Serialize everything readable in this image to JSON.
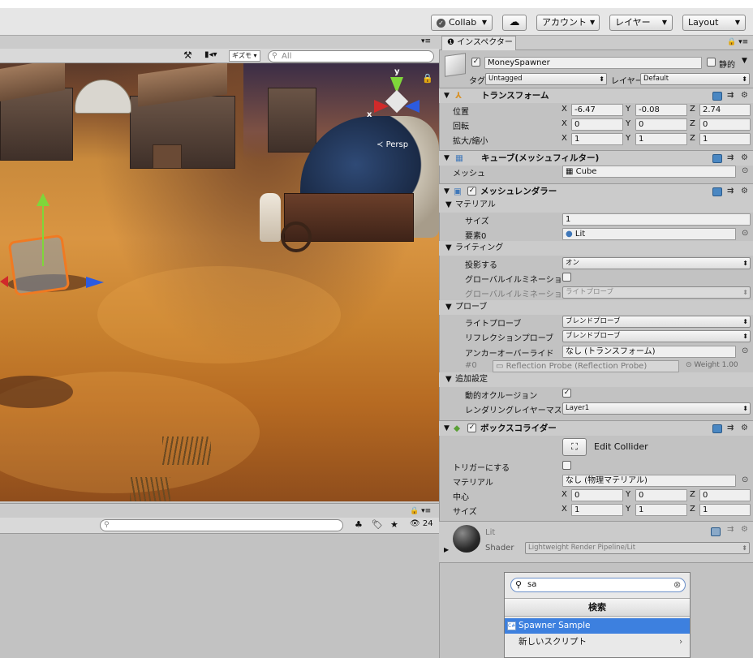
{
  "toolbar": {
    "collab": "Collab",
    "account": "アカウント",
    "layers": "レイヤー",
    "layout": "Layout"
  },
  "scene": {
    "gizmos_label": "ギズモ",
    "search_placeholder": "All",
    "persp_label": "Persp",
    "axis_x": "x",
    "axis_y": "y"
  },
  "lower_panel": {
    "count_badge": "24"
  },
  "inspector": {
    "tab_label": "インスペクター",
    "object_name": "MoneySpawner",
    "static_label": "静的",
    "tag_label": "タグ",
    "tag_value": "Untagged",
    "layer_label": "レイヤー",
    "layer_value": "Default",
    "transform": {
      "title": "トランスフォーム",
      "position_label": "位置",
      "rotation_label": "回転",
      "scale_label": "拡大/縮小",
      "position": {
        "x": "-6.47",
        "y": "-0.08",
        "z": "2.74"
      },
      "rotation": {
        "x": "0",
        "y": "0",
        "z": "0"
      },
      "scale": {
        "x": "1",
        "y": "1",
        "z": "1"
      }
    },
    "mesh_filter": {
      "title": "キューブ(メッシュフィルター)",
      "mesh_label": "メッシュ",
      "mesh_value": "Cube"
    },
    "mesh_renderer": {
      "title": "メッシュレンダラー",
      "materials_label": "マテリアル",
      "size_label": "サイズ",
      "size_value": "1",
      "element0_label": "要素0",
      "element0_value": "Lit",
      "lighting_label": "ライティング",
      "cast_shadows_label": "投影する",
      "cast_shadows_value": "オン",
      "gi_label": "グローバルイルミネーションに影",
      "gi_receive_label": "グローバルイルミネーションを受",
      "gi_receive_value": "ライトプローブ",
      "probes_label": "プローブ",
      "light_probes_label": "ライトプローブ",
      "light_probes_value": "ブレンドプローブ",
      "reflection_probes_label": "リフレクションプローブ",
      "reflection_probes_value": "ブレンドプローブ",
      "anchor_label": "アンカーオーバーライド",
      "anchor_value": "なし (トランスフォーム)",
      "probe_index": "#0",
      "probe_value": "Reflection Probe (Reflection Probe)",
      "weight_label": "Weight 1.00",
      "additional_label": "追加設定",
      "dynamic_occlusion_label": "動的オクルージョン",
      "rendering_layer_label": "レンダリングレイヤーマスクの値",
      "rendering_layer_value": "Layer1"
    },
    "box_collider": {
      "title": "ボックスコライダー",
      "edit_collider": "Edit Collider",
      "trigger_label": "トリガーにする",
      "material_label": "マテリアル",
      "material_value": "なし (物理マテリアル)",
      "center_label": "中心",
      "size_label": "サイズ",
      "center": {
        "x": "0",
        "y": "0",
        "z": "0"
      },
      "size": {
        "x": "1",
        "y": "1",
        "z": "1"
      }
    },
    "material": {
      "name": "Lit",
      "shader_label": "Shader",
      "shader_value": "Lightweight Render Pipeline/Lit"
    }
  },
  "popup": {
    "search_value": "sa",
    "header": "検索",
    "items": [
      {
        "label": "Spawner Sample"
      },
      {
        "label": "新しいスクリプト"
      }
    ]
  },
  "colors": {
    "selection": "#3d80df",
    "accent_blue": "#3b6fd1",
    "panel": "#c2c2c2"
  }
}
